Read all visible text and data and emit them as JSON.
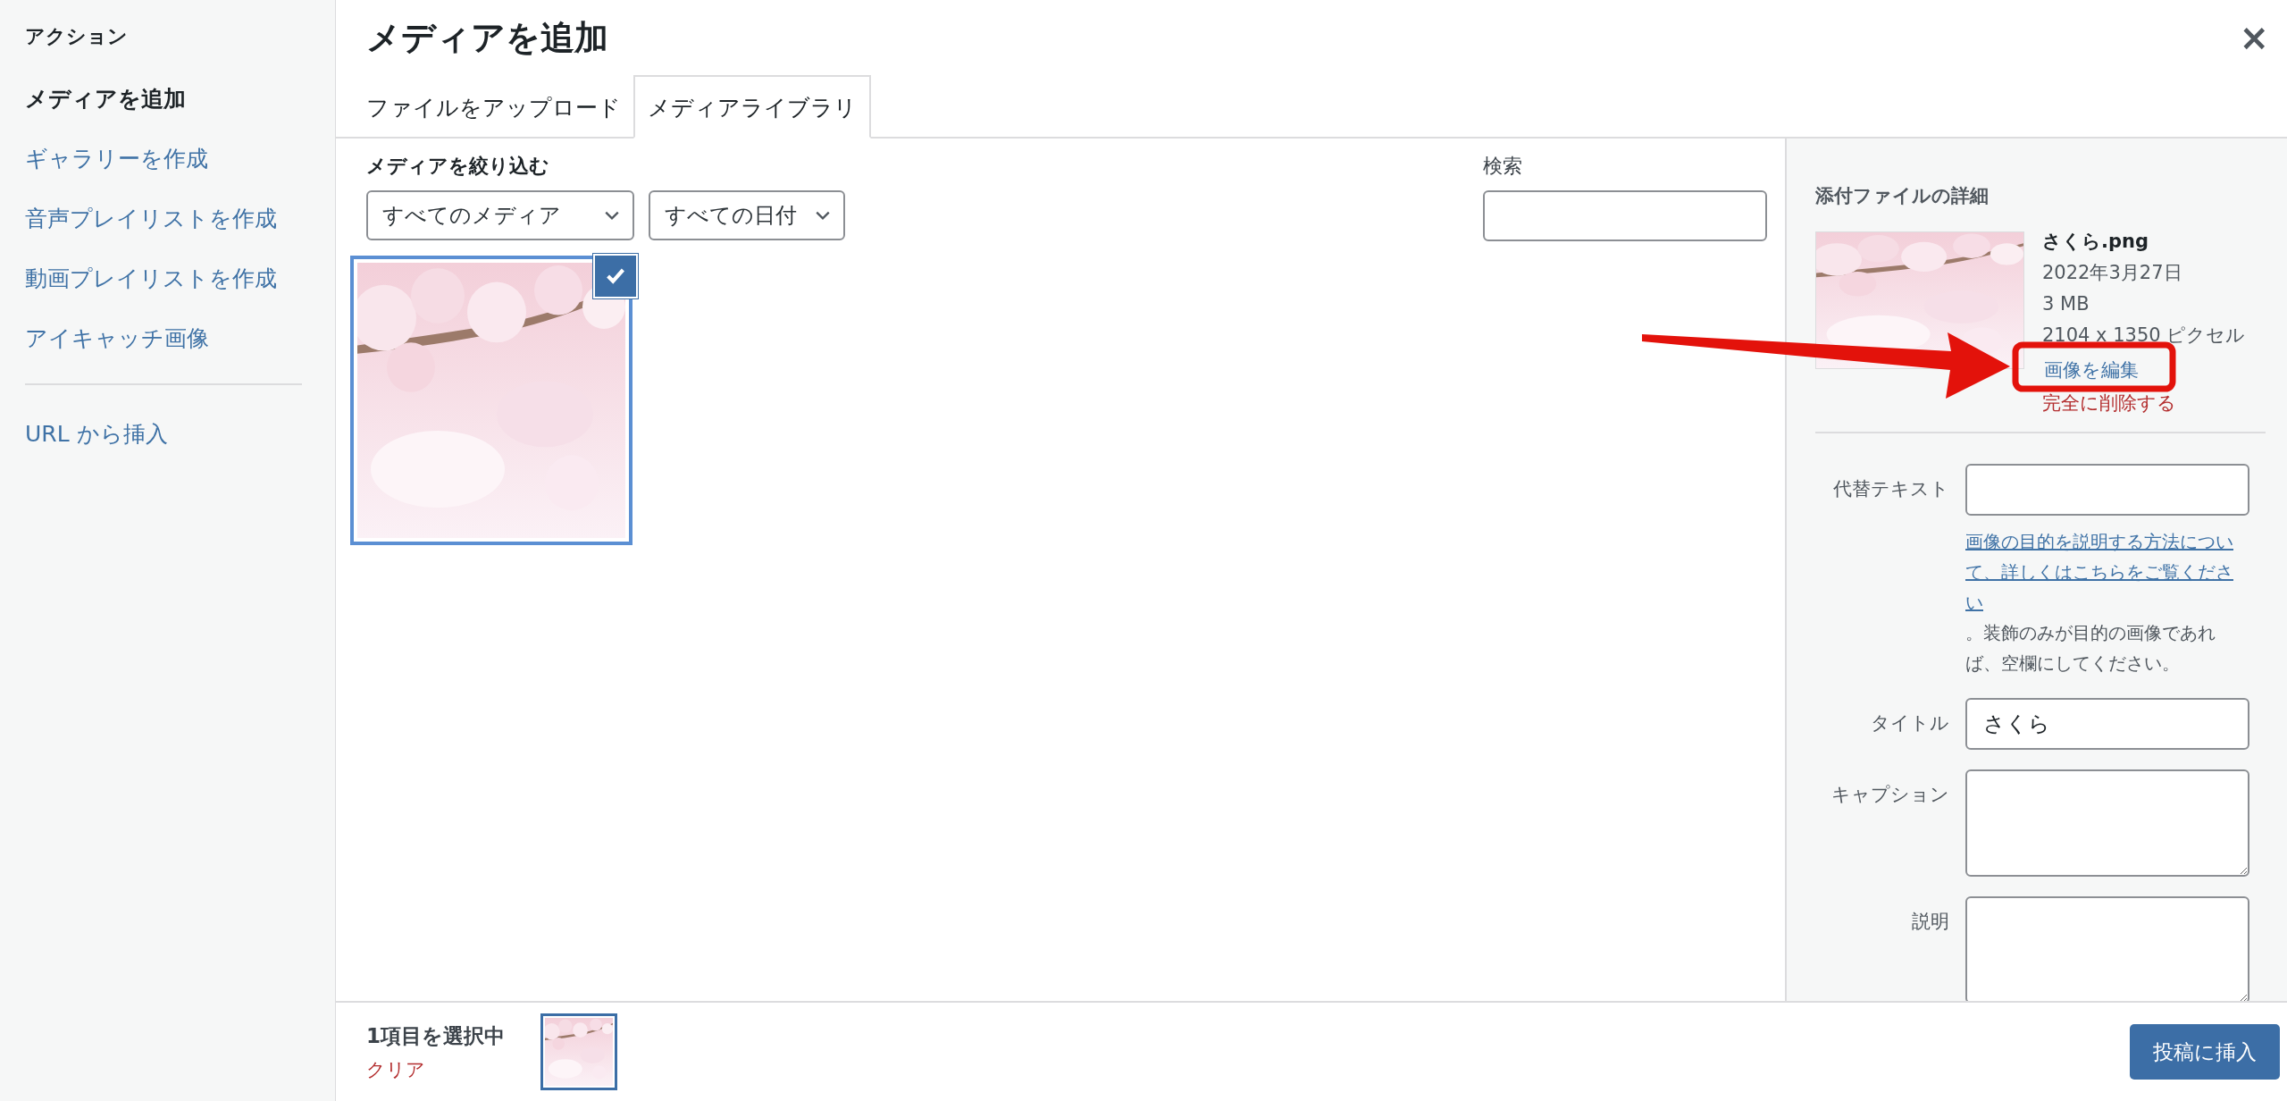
{
  "sidebar": {
    "heading": "アクション",
    "sections": [
      {
        "items": [
          {
            "label": "メディアを追加",
            "selected": true
          },
          {
            "label": "ギャラリーを作成",
            "selected": false
          },
          {
            "label": "音声プレイリストを作成",
            "selected": false
          },
          {
            "label": "動画プレイリストを作成",
            "selected": false
          },
          {
            "label": "アイキャッチ画像",
            "selected": false
          }
        ]
      },
      {
        "items": [
          {
            "label": "URL から挿入",
            "selected": false
          }
        ]
      }
    ]
  },
  "window": {
    "title": "メディアを追加",
    "close": "×"
  },
  "tabs": [
    {
      "label": "ファイルをアップロード",
      "selected": false
    },
    {
      "label": "メディアライブラリ",
      "selected": true
    }
  ],
  "filters": {
    "label": "メディアを絞り込む",
    "dropdowns": [
      {
        "value": "すべてのメディア"
      },
      {
        "value": "すべての日付"
      }
    ],
    "search": {
      "label": "検索"
    }
  },
  "media": {
    "items": [
      {
        "kind": "picture",
        "selected": true
      }
    ]
  },
  "details": {
    "heading": "添付ファイルの詳細",
    "filename": "さくら.png",
    "date": "2022年3月27日",
    "size": "3 MB",
    "dimensions": "2104 x 1350 ピクセル",
    "edit_link": "画像を編集",
    "delete_link": "完全に削除する",
    "fields": [
      {
        "label": "代替テキスト",
        "kind": "input",
        "help_link": "画像の目的を説明する方法について、詳しくはこちらをご覧ください",
        "help_text": "。装飾のみが目的の画像であれば、空欄にしてください。"
      },
      {
        "label": "タイトル",
        "kind": "input",
        "value": "さくら"
      },
      {
        "label": "キャプション",
        "kind": "textarea"
      },
      {
        "label": "説明",
        "kind": "textarea"
      }
    ]
  },
  "toolbar": {
    "selection": "1項目を選択中",
    "clear": "クリア",
    "thumbnails": [
      {
        "kind": "picture"
      }
    ],
    "insert_button": "投稿に挿入"
  },
  "annotation": {
    "kind": "arrow-box"
  }
}
